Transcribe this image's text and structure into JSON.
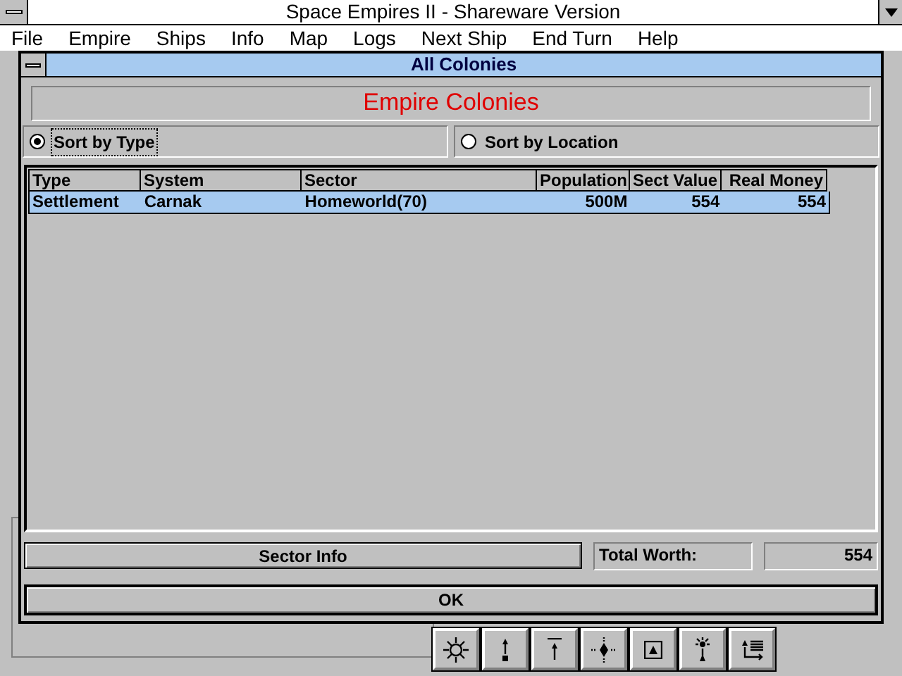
{
  "window": {
    "title": "Space Empires II - Shareware Version"
  },
  "menu": [
    "File",
    "Empire",
    "Ships",
    "Info",
    "Map",
    "Logs",
    "Next Ship",
    "End Turn",
    "Help"
  ],
  "dialog": {
    "title": "All Colonies",
    "heading": "Empire Colonies",
    "sort_options": [
      {
        "label": "Sort by Type",
        "selected": true
      },
      {
        "label": "Sort by Location",
        "selected": false
      }
    ],
    "table": {
      "columns": [
        "Type",
        "System",
        "Sector",
        "Population",
        "Sect Value",
        "Real Money"
      ],
      "rows": [
        {
          "selected": true,
          "cells": [
            "Settlement",
            "Carnak",
            "Homeworld(70)",
            "500M",
            "554",
            "554"
          ]
        }
      ]
    },
    "sector_info_button": "Sector Info",
    "total_worth_label": "Total Worth:",
    "total_worth": "554",
    "ok_button": "OK"
  },
  "toolbar": [
    {
      "kind": "sun"
    },
    {
      "kind": "lift"
    },
    {
      "kind": "raise"
    },
    {
      "kind": "star"
    },
    {
      "kind": "frame"
    },
    {
      "kind": "beacon"
    },
    {
      "kind": "list"
    }
  ]
}
